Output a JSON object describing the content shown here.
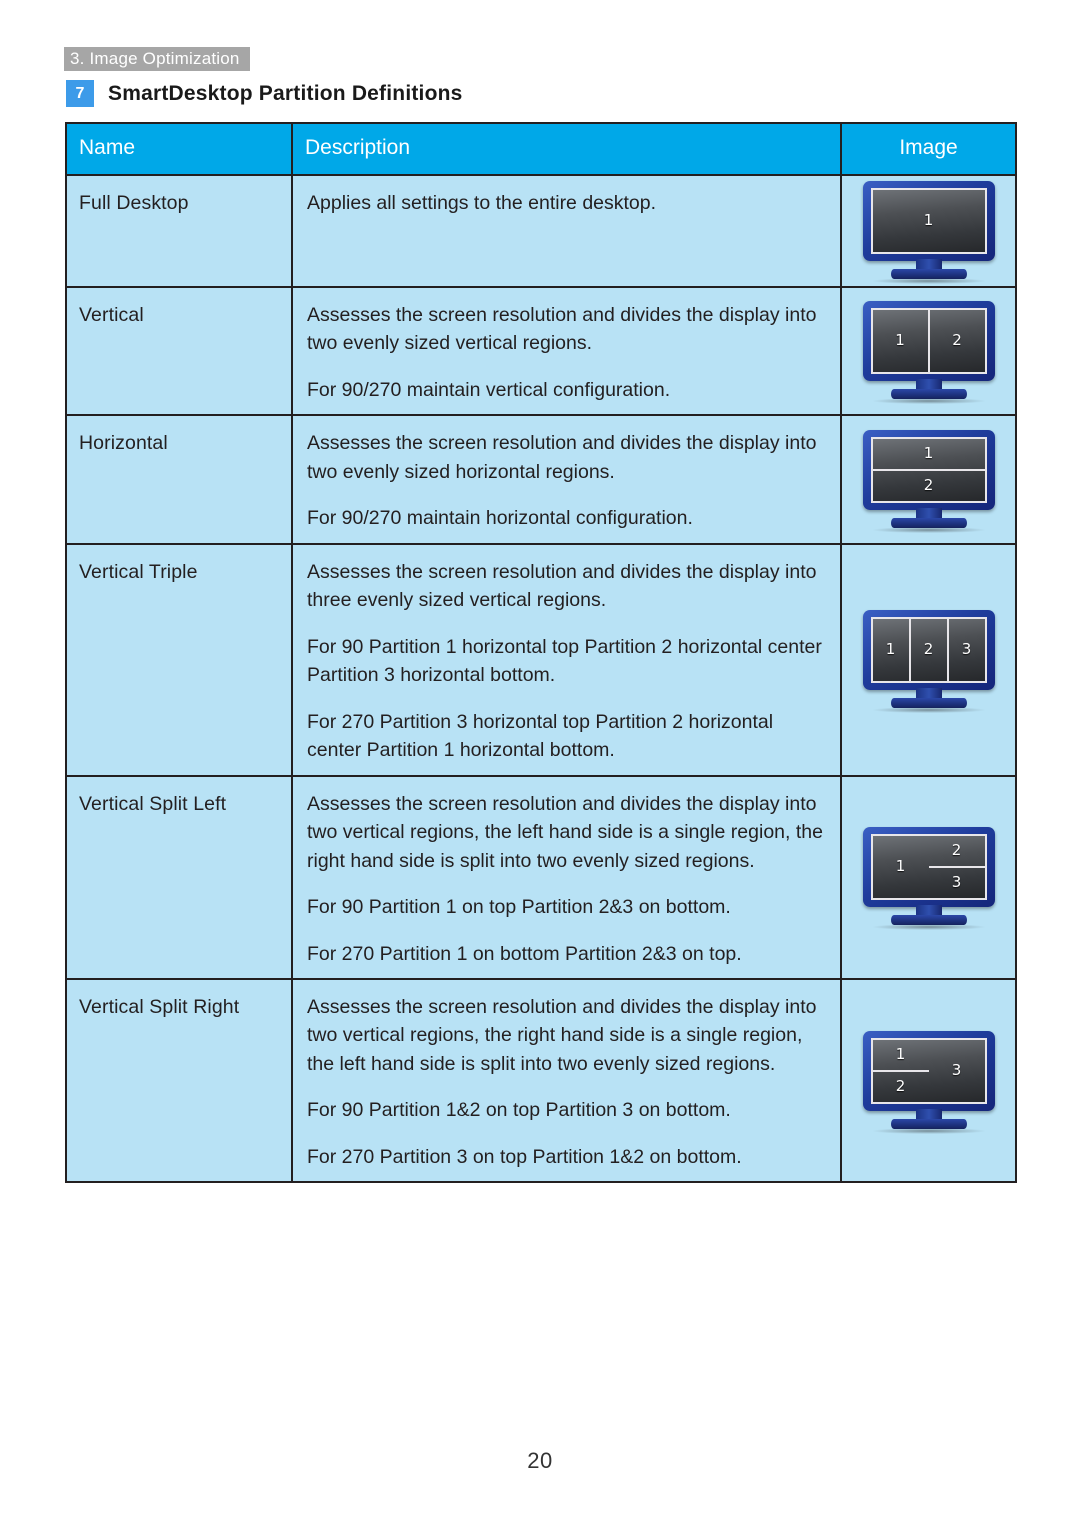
{
  "running_head": "3. Image Optimization",
  "section": {
    "badge": "7",
    "title": "SmartDesktop Partition Definitions"
  },
  "colors": {
    "header_band": "#a6a6a6",
    "badge_blue": "#3d9be9",
    "table_header_blue": "#00a8e8",
    "table_cell_blue": "#b8e2f5",
    "border": "#231f20",
    "monitor_bezel": "#1f3c9c"
  },
  "table": {
    "columns": [
      "Name",
      "Description",
      "Image"
    ],
    "rows": [
      {
        "name": "Full Desktop",
        "description": [
          "Applies all settings to the entire desktop."
        ],
        "image": {
          "icon": "monitor-icon",
          "layout": "full",
          "panes": [
            "1"
          ]
        }
      },
      {
        "name": "Vertical",
        "description": [
          "Assesses the screen resolution and divides the display into two evenly sized vertical regions.",
          "For 90/270 maintain vertical configuration."
        ],
        "image": {
          "icon": "monitor-icon",
          "layout": "vertical-2",
          "panes": [
            "1",
            "2"
          ]
        }
      },
      {
        "name": "Horizontal",
        "description": [
          "Assesses the screen resolution and divides the display into two evenly sized horizontal regions.",
          "For 90/270 maintain horizontal configuration."
        ],
        "image": {
          "icon": "monitor-icon",
          "layout": "horizontal-2",
          "panes": [
            "1",
            "2"
          ]
        }
      },
      {
        "name": "Vertical Triple",
        "description": [
          "Assesses the screen resolution and divides the display into three evenly sized vertical regions.",
          "For 90 Partition 1 horizontal top Partition 2 horizontal center Partition 3 horizontal bottom.",
          "For 270 Partition 3 horizontal top Partition 2 horizontal center Partition 1 horizontal bottom."
        ],
        "image": {
          "icon": "monitor-icon",
          "layout": "vertical-3",
          "panes": [
            "1",
            "2",
            "3"
          ]
        }
      },
      {
        "name": "Vertical Split Left",
        "description": [
          "Assesses the screen resolution and divides the display into two vertical regions, the left hand side is a single region, the right hand side is split into two evenly sized regions.",
          "For 90 Partition 1 on top Partition 2&3 on bottom.",
          "For 270 Partition 1 on bottom Partition 2&3 on top."
        ],
        "image": {
          "icon": "monitor-icon",
          "layout": "split-left",
          "panes": [
            "1",
            "2",
            "3"
          ]
        }
      },
      {
        "name": "Vertical Split Right",
        "description": [
          "Assesses the screen resolution and divides the display into two vertical regions, the right  hand side is a single region, the left  hand side is split into two evenly sized regions.",
          "For 90 Partition 1&2  on top Partition 3 on bottom.",
          "For 270 Partition 3 on top Partition 1&2 on bottom."
        ],
        "image": {
          "icon": "monitor-icon",
          "layout": "split-right",
          "panes": [
            "1",
            "2",
            "3"
          ]
        }
      }
    ]
  },
  "page_number": "20"
}
